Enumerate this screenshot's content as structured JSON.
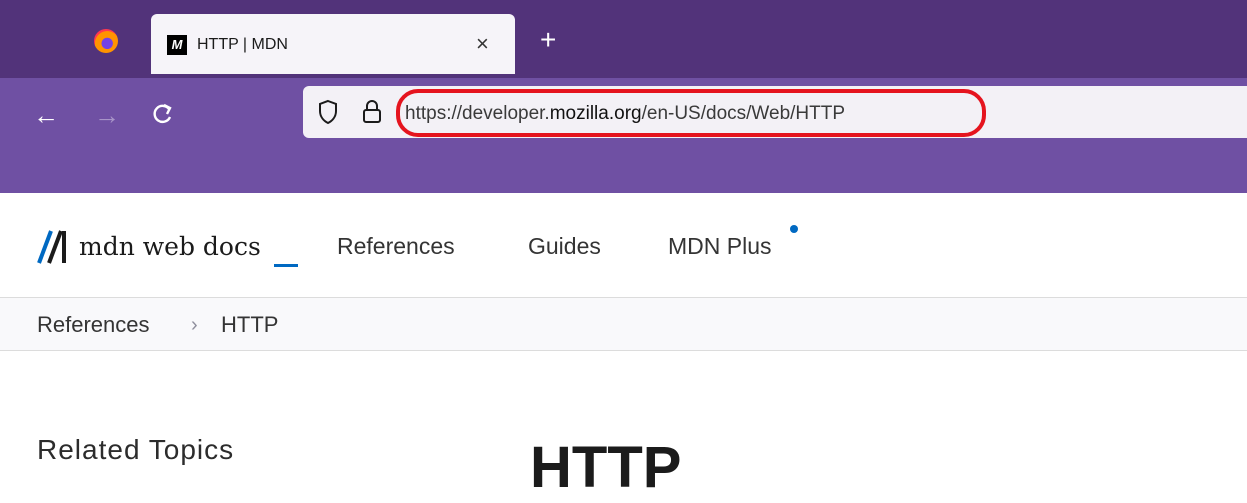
{
  "browser": {
    "tab": {
      "favicon_text": "M",
      "title": "HTTP | MDN",
      "close_glyph": "×"
    },
    "new_tab_glyph": "+",
    "nav": {
      "back_glyph": "←",
      "forward_glyph": "→",
      "reload_glyph": "C"
    },
    "url": {
      "prefix": "https://developer.",
      "domain": "mozilla.org",
      "path": "/en-US/docs/Web/HTTP"
    },
    "highlight_color": "#e5141e"
  },
  "header": {
    "logo_text": "mdn web docs",
    "nav": [
      "References",
      "Guides",
      "MDN Plus"
    ]
  },
  "breadcrumb": {
    "items": [
      "References",
      "HTTP"
    ],
    "separator": "›"
  },
  "sidebar": {
    "title": "Related Topics"
  },
  "main": {
    "title": "HTTP"
  },
  "colors": {
    "tabbar": "#52337a",
    "toolbar": "#6f50a3",
    "accent": "#0069c2"
  }
}
